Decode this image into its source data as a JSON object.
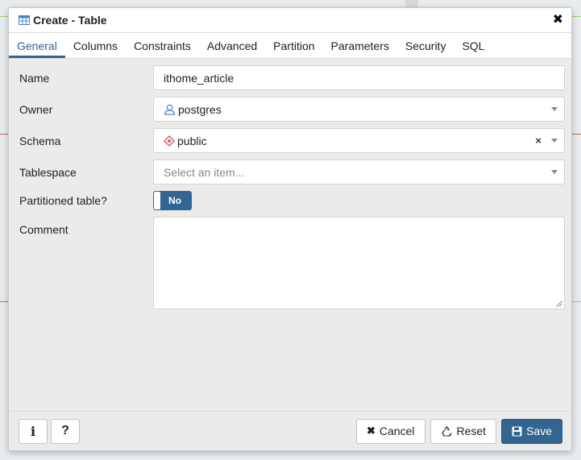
{
  "dialog": {
    "title": "Create - Table"
  },
  "tabs": [
    {
      "label": "General",
      "active": true
    },
    {
      "label": "Columns"
    },
    {
      "label": "Constraints"
    },
    {
      "label": "Advanced"
    },
    {
      "label": "Partition"
    },
    {
      "label": "Parameters"
    },
    {
      "label": "Security"
    },
    {
      "label": "SQL"
    }
  ],
  "form": {
    "name": {
      "label": "Name",
      "value": "ithome_article"
    },
    "owner": {
      "label": "Owner",
      "value": "postgres",
      "icon": "user-icon"
    },
    "schema": {
      "label": "Schema",
      "value": "public",
      "icon": "schema-diamond-icon"
    },
    "tablespace": {
      "label": "Tablespace",
      "placeholder": "Select an item..."
    },
    "partitioned": {
      "label": "Partitioned table?",
      "value": "No"
    },
    "comment": {
      "label": "Comment",
      "value": ""
    }
  },
  "footer": {
    "info_label": "i",
    "help_label": "?",
    "cancel_label": "Cancel",
    "reset_label": "Reset",
    "save_label": "Save"
  },
  "colors": {
    "accent": "#326690",
    "schema_icon": "#d9534f"
  }
}
